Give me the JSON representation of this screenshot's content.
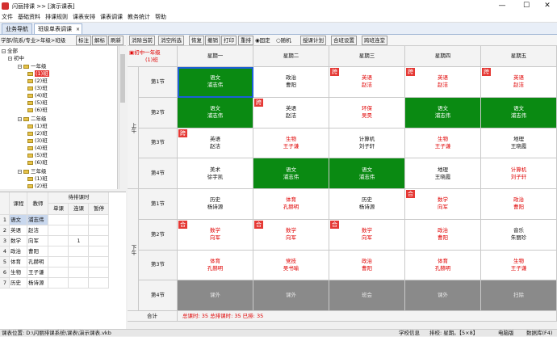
{
  "window": {
    "title": "闪丽排课 >> [演示课表]",
    "minimize": "—",
    "maximize": "☐",
    "close": "✕"
  },
  "menu": [
    "文件",
    "基础资料",
    "排课规则",
    "课表安排",
    "课表调课",
    "教务统计",
    "帮助"
  ],
  "tabs": [
    "业务导航",
    "班级单表调课",
    "×"
  ],
  "left_toolbar": {
    "path_label": "学部/院系/专业>年级>班级",
    "btn1": "标注",
    "btn2": "解标",
    "btn3": "刷新"
  },
  "tree": {
    "root": "全部",
    "group": "初中",
    "grade1": "一年级",
    "grade1_classes": [
      "(1)班",
      "(2)班",
      "(3)班",
      "(4)班",
      "(5)班",
      "(6)班"
    ],
    "grade2": "二年级",
    "grade2_classes": [
      "(1)班",
      "(2)班",
      "(3)班",
      "(4)班",
      "(5)班",
      "(6)班"
    ],
    "grade3": "三年级",
    "grade3_classes": [
      "(1)班",
      "(2)班"
    ]
  },
  "task_table": {
    "headers": [
      "课程",
      "教师",
      "待排课时"
    ],
    "subheaders": [
      "单课",
      "连课",
      "暂停"
    ],
    "rows": [
      [
        "1",
        "语文",
        "浦志伟",
        "",
        "",
        ""
      ],
      [
        "2",
        "英语",
        "赵洁",
        "",
        "",
        ""
      ],
      [
        "3",
        "数学",
        "向军",
        "",
        "1",
        ""
      ],
      [
        "4",
        "政治",
        "曹阳",
        "",
        "",
        ""
      ],
      [
        "5",
        "体育",
        "孔赫明",
        "",
        "",
        ""
      ],
      [
        "6",
        "生物",
        "王子谦",
        "",
        "",
        ""
      ],
      [
        "7",
        "历史",
        "杨诗源",
        "",
        "",
        ""
      ]
    ]
  },
  "toolbar": [
    "消除当前",
    "消空所选",
    "恢复",
    "撤销",
    "打印",
    "重排",
    "固定",
    "随机",
    "授课计划",
    "合班设置",
    "跨班连堂"
  ],
  "timetable": {
    "corner_line1": "初中一年级",
    "corner_line2": "(1)班",
    "days": [
      "星期一",
      "星期二",
      "星期三",
      "星期四",
      "星期五"
    ],
    "sessions": [
      "上午",
      "下午"
    ],
    "periods": [
      "第1节",
      "第2节",
      "第3节",
      "第4节",
      "第1节",
      "第2节",
      "第3节",
      "第4节"
    ],
    "cells": [
      [
        {
          "s": "语文",
          "t": "浦志伟",
          "c": "green",
          "sel": true
        },
        {
          "s": "政治",
          "t": "曹阳",
          "c": ""
        },
        {
          "s": "英语",
          "t": "赵洁",
          "c": "red",
          "mk": "跨"
        },
        {
          "s": "英语",
          "t": "赵洁",
          "c": "red",
          "mk": "跨"
        },
        {
          "s": "英语",
          "t": "赵洁",
          "c": "red",
          "mk": "跨"
        }
      ],
      [
        {
          "s": "语文",
          "t": "浦志伟",
          "c": "green"
        },
        {
          "s": "英语",
          "t": "赵洁",
          "c": "",
          "mk": "跨"
        },
        {
          "s": "环保",
          "t": "吴昊",
          "c": "red"
        },
        {
          "s": "语文",
          "t": "浦志伟",
          "c": "green"
        },
        {
          "s": "语文",
          "t": "浦志伟",
          "c": "green"
        }
      ],
      [
        {
          "s": "英语",
          "t": "赵洁",
          "c": "",
          "mk": "跨"
        },
        {
          "s": "生物",
          "t": "王子谦",
          "c": "red"
        },
        {
          "s": "计算机",
          "t": "刘子轩",
          "c": ""
        },
        {
          "s": "生物",
          "t": "王子谦",
          "c": "red"
        },
        {
          "s": "地理",
          "t": "王晓霞",
          "c": ""
        }
      ],
      [
        {
          "s": "美术",
          "t": "徐宇凯",
          "c": ""
        },
        {
          "s": "语文",
          "t": "浦志伟",
          "c": "green"
        },
        {
          "s": "语文",
          "t": "浦志伟",
          "c": "green"
        },
        {
          "s": "地理",
          "t": "王晓霞",
          "c": ""
        },
        {
          "s": "计算机",
          "t": "刘子轩",
          "c": "red"
        }
      ],
      [
        {
          "s": "历史",
          "t": "杨诗源",
          "c": ""
        },
        {
          "s": "体育",
          "t": "孔赫明",
          "c": "red"
        },
        {
          "s": "历史",
          "t": "杨诗源",
          "c": ""
        },
        {
          "s": "数学",
          "t": "向军",
          "c": "red",
          "mk": "合"
        },
        {
          "s": "政治",
          "t": "曹阳",
          "c": "red"
        }
      ],
      [
        {
          "s": "数学",
          "t": "向军",
          "c": "red",
          "mk": "合"
        },
        {
          "s": "数学",
          "t": "向军",
          "c": "red",
          "mk": "合"
        },
        {
          "s": "数学",
          "t": "向军",
          "c": "red",
          "mk": "合"
        },
        {
          "s": "政治",
          "t": "曹阳",
          "c": "red"
        },
        {
          "s": "音乐",
          "t": "朱丽珍",
          "c": ""
        }
      ],
      [
        {
          "s": "体育",
          "t": "孔赫明",
          "c": "red"
        },
        {
          "s": "党技",
          "t": "吴书喻",
          "c": "red"
        },
        {
          "s": "政治",
          "t": "曹阳",
          "c": "red"
        },
        {
          "s": "体育",
          "t": "孔赫明",
          "c": "red"
        },
        {
          "s": "生物",
          "t": "王子谦",
          "c": "red"
        }
      ],
      [
        {
          "s": "课外",
          "t": "",
          "c": "gray"
        },
        {
          "s": "课外",
          "t": "",
          "c": "gray"
        },
        {
          "s": "班会",
          "t": "",
          "c": "gray"
        },
        {
          "s": "课外",
          "t": "",
          "c": "gray"
        },
        {
          "s": "扫除",
          "t": "",
          "c": "gray"
        }
      ]
    ],
    "total_label": "合计",
    "total_text": "总课时: 35 总排课时: 35 已排: 35"
  },
  "status": {
    "path": "课表位置: D:\\闪丽排课系统\\课表\\演示课表.vkb",
    "school": "学校信息",
    "mode": "排校: 星期。【5×8】",
    "version": "电脑版",
    "sync": "数据库(F4)"
  },
  "colors": {
    "green": "#0a8a12",
    "red": "#e00000",
    "gray": "#8a8a8a",
    "highlight": "#e53935"
  }
}
